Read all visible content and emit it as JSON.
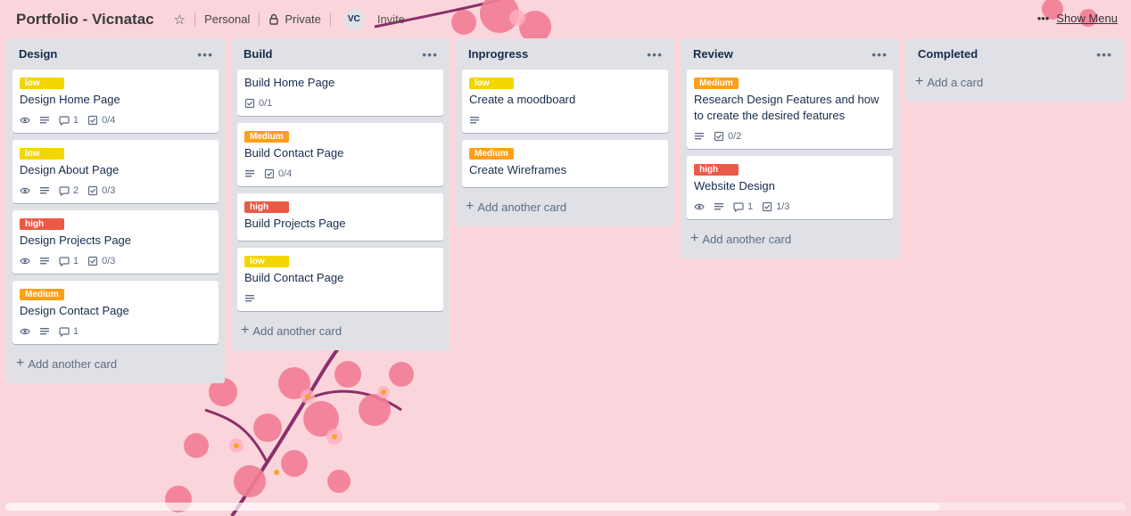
{
  "header": {
    "board_title": "Portfolio - Vicnatac",
    "team": "Personal",
    "visibility": "Private",
    "avatar_initials": "VC",
    "invite": "Invite",
    "show_menu": "Show Menu"
  },
  "colors": {
    "background": "#fbd8df",
    "list_bg": "#dfe1e6",
    "label_low": "#f2d600",
    "label_medium": "#ff9f1a",
    "label_high": "#eb5a46"
  },
  "lists": [
    {
      "title": "Design",
      "add_label": "Add another card",
      "cards": [
        {
          "label": "low",
          "title": "Design Home Page",
          "watch": true,
          "desc": true,
          "comments": "1",
          "checklist": "0/4"
        },
        {
          "label": "low",
          "title": "Design About Page",
          "watch": true,
          "desc": true,
          "comments": "2",
          "checklist": "0/3"
        },
        {
          "label": "high",
          "title": "Design Projects Page",
          "watch": true,
          "desc": true,
          "comments": "1",
          "checklist": "0/3"
        },
        {
          "label": "Medium",
          "title": "Design Contact Page",
          "watch": true,
          "desc": true,
          "comments": "1",
          "checklist": ""
        }
      ]
    },
    {
      "title": "Build",
      "add_label": "Add another card",
      "cards": [
        {
          "label": "",
          "title": "Build Home Page",
          "watch": false,
          "desc": false,
          "comments": "",
          "checklist": "0/1"
        },
        {
          "label": "Medium",
          "title": "Build Contact Page",
          "watch": false,
          "desc": true,
          "comments": "",
          "checklist": "0/4"
        },
        {
          "label": "high",
          "title": "Build Projects Page",
          "watch": false,
          "desc": false,
          "comments": "",
          "checklist": ""
        },
        {
          "label": "low",
          "title": "Build Contact Page",
          "watch": false,
          "desc": true,
          "comments": "",
          "checklist": ""
        }
      ]
    },
    {
      "title": "Inprogress",
      "add_label": "Add another card",
      "cards": [
        {
          "label": "low",
          "title": "Create a moodboard",
          "watch": false,
          "desc": true,
          "comments": "",
          "checklist": ""
        },
        {
          "label": "Medium",
          "title": "Create Wireframes",
          "watch": false,
          "desc": false,
          "comments": "",
          "checklist": ""
        }
      ]
    },
    {
      "title": "Review",
      "add_label": "Add another card",
      "cards": [
        {
          "label": "Medium",
          "title": "Research Design Features and how to create the desired features",
          "watch": false,
          "desc": true,
          "comments": "",
          "checklist": "0/2"
        },
        {
          "label": "high",
          "title": "Website Design",
          "watch": true,
          "desc": true,
          "comments": "1",
          "checklist": "1/3"
        }
      ]
    },
    {
      "title": "Completed",
      "add_label": "Add a card",
      "cards": []
    }
  ]
}
